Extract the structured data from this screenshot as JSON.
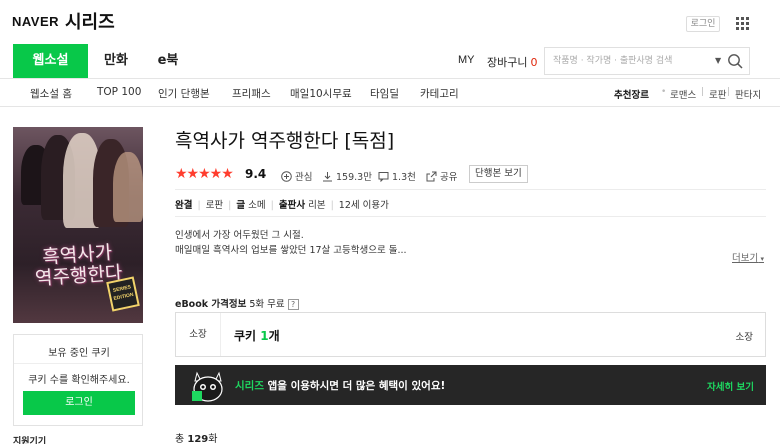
{
  "header": {
    "brand": "NAVER",
    "service": "시리즈",
    "login_label": "로그인",
    "apps_icon": "grid-icon"
  },
  "nav": {
    "tabs": [
      {
        "label": "웹소설",
        "active": true
      },
      {
        "label": "만화",
        "active": false
      },
      {
        "label": "e북",
        "active": false
      }
    ],
    "my_label": "MY",
    "cart_label": "장바구니",
    "cart_count": "0",
    "search_placeholder": "작품명 · 작가명 · 출판사명 검색"
  },
  "subnav": {
    "items": [
      "웹소설 홈",
      "TOP 100",
      "인기 단행본",
      "프리패스",
      "매일10시무료",
      "타임딜",
      "카테고리"
    ],
    "genre_label": "추천장르",
    "genres": [
      "로맨스",
      "로판",
      "판타지"
    ]
  },
  "cover": {
    "title": "흑역사가 역주행한다",
    "badge": "SERIES EDITION"
  },
  "coupon": {
    "title": "보유 중인 쿠키",
    "message": "쿠키 수를 확인해주세요.",
    "login_button": "로그인"
  },
  "devices_label": "지원기기",
  "product": {
    "title": "흑역사가 역주행한다 [독점]",
    "stars": "★★★★★",
    "rating": "9.4",
    "interest_label": "관심",
    "downloads": "159.3만",
    "comments": "1.3천",
    "share_label": "공유",
    "volume_button": "단행본 보기",
    "status": "완결",
    "genre": "로판",
    "author_label": "글",
    "author": "소메",
    "publisher_label": "출판사",
    "publisher": "리본",
    "age": "12세 이용가",
    "synopsis": [
      "인생에서 가장 어두웠던 그 시절.",
      "매일매일 흑역사의 업보를 쌓았던 17살 고등학생으로 돌..."
    ],
    "more_label": "더보기"
  },
  "ebook": {
    "label": "eBook 가격정보",
    "free_note": "5화 무료",
    "own_label": "소장",
    "price_prefix": "쿠키",
    "price_amount": "1",
    "price_unit": "개",
    "own_right": "소장"
  },
  "promo": {
    "brand": "시리즈",
    "text": "앱을 이용하시면 더 많은 혜택이 있어요!",
    "link": "자세히 보기"
  },
  "episodes": {
    "prefix": "총",
    "count": "129",
    "unit": "화"
  },
  "colors": {
    "brand_green": "#08c849",
    "star_red": "#ff3d2e",
    "cart_red": "#e0270c",
    "promo_bg": "#262626"
  }
}
